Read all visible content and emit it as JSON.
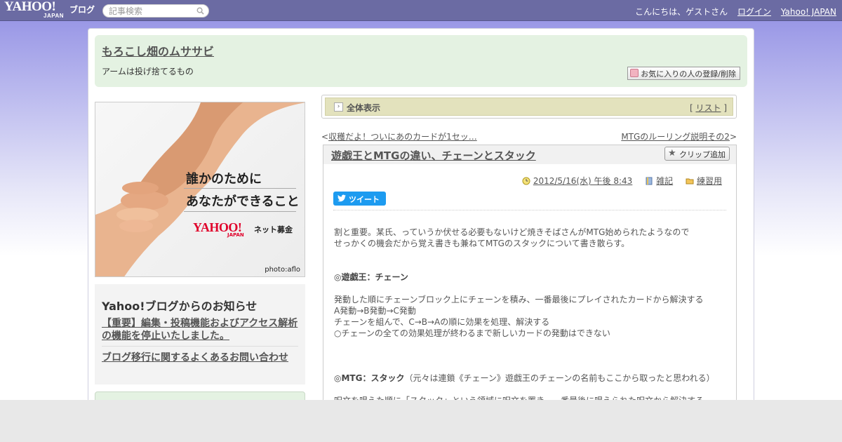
{
  "topbar": {
    "logo_yahoo": "YAHOO!",
    "logo_japan": "JAPAN",
    "logo_blog": "ブログ",
    "search_placeholder": "記事検索",
    "greeting": "こんにちは、ゲストさん",
    "login": "ログイン",
    "yahoo_japan": "Yahoo! JAPAN"
  },
  "blog": {
    "title": "もろこし畑のムササビ",
    "description": "アームは投げ捨てるもの",
    "fav_button": "お気に入りの人の登録/削除"
  },
  "ad": {
    "line1": "誰かのために",
    "line2": "あなたができること",
    "yahoo": "YAHOO!",
    "japan": "JAPAN",
    "net": "ネット募金",
    "credit": "photo:aflo"
  },
  "notice": {
    "heading": "Yahoo!ブログからのお知らせ",
    "item1": "【重要】編集・投稿機能およびアクセス解析の機能を停止いたしました。",
    "item2": "ブログ移行に関するよくあるお問い合わせ"
  },
  "category_bar": {
    "label": "全体表示",
    "bracket_open": "[ ",
    "list_link": "リスト",
    "bracket_close": " ]"
  },
  "pager": {
    "prev_arrow": "<",
    "prev": "収穫だよ！ついにあのカードが1セッ…",
    "next": "MTGのルーリング説明その2",
    "next_arrow": ">"
  },
  "article": {
    "title": "遊戯王とMTGの違い、チェーンとスタック",
    "clip_button": "クリップ追加",
    "datetime": "2012/5/16(水) 午後 8:43",
    "category1": "雑記",
    "category2": "練習用",
    "tweet": "ツイート",
    "para1_line1": "割と重要。某氏、っていうか伏せる必要もないけど焼きそばさんがMTG始められたようなので",
    "para1_line2": "せっかくの機会だから覚え書きも兼ねてMTGのスタックについて書き散らす。",
    "heading1": "◎遊戯王：チェーン",
    "para2_line1": "発動した順にチェーンブロック上にチェーンを積み、一番最後にプレイされたカードから解決する",
    "para2_line2": "A発動→B発動→C発動",
    "para2_line3": "チェーンを組んで、C→B→Aの順に効果を処理、解決する",
    "para2_line4": "○チェーンの全ての効果処理が終わるまで新しいカードの発動はできない",
    "heading2": "◎MTG：スタック",
    "heading2_note": "（元々は連鎖《チェーン》遊戯王のチェーンの名前もここから取ったと思われる）",
    "para3_line1": "呪文を唱えた順に「スタック」という領域に呪文を置き、一番最後に唱えられた呪文から解決する"
  },
  "colors": {
    "topbar": "#6b6ba3",
    "header_green": "#e4f2e2",
    "category_bar": "#e3e2bd",
    "tweet_blue": "#1d9bf0"
  }
}
